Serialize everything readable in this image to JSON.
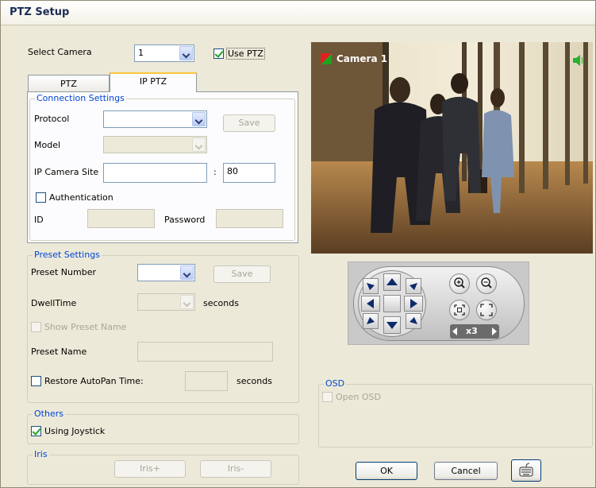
{
  "window": {
    "title": "PTZ Setup"
  },
  "camera": {
    "label": "Select Camera",
    "value": "1",
    "use_ptz_label": "Use PTZ",
    "use_ptz_checked": true
  },
  "tabs": [
    {
      "label": "PTZ",
      "active": false
    },
    {
      "label": "IP PTZ",
      "active": true
    }
  ],
  "connection": {
    "legend": "Connection Settings",
    "protocol_label": "Protocol",
    "protocol_value": "",
    "save_label": "Save",
    "model_label": "Model",
    "model_value": "",
    "site_label": "IP Camera Site",
    "site_value": "",
    "port_sep": ":",
    "port_value": "80",
    "auth_label": "Authentication",
    "auth_checked": false,
    "id_label": "ID",
    "id_value": "",
    "password_label": "Password",
    "password_value": ""
  },
  "preset": {
    "legend": "Preset Settings",
    "number_label": "Preset Number",
    "number_value": "",
    "save_label": "Save",
    "dwell_label": "DwellTime",
    "dwell_value": "",
    "dwell_unit": "seconds",
    "show_name_label": "Show Preset Name",
    "name_label": "Preset Name",
    "name_value": "",
    "autopan_label": "Restore AutoPan Time:",
    "autopan_value": "",
    "autopan_unit": "seconds"
  },
  "others": {
    "legend": "Others",
    "joystick_label": "Using Joystick",
    "joystick_checked": true
  },
  "iris": {
    "legend": "Iris",
    "plus_label": "Iris+",
    "minus_label": "Iris-"
  },
  "video": {
    "camera_label": "Camera 1"
  },
  "ptz_panel": {
    "zoom_label": "x3"
  },
  "osd": {
    "legend": "OSD",
    "open_label": "Open OSD"
  },
  "buttons": {
    "ok": "OK",
    "cancel": "Cancel"
  },
  "icons": {
    "dropdown": "chevron-down-icon",
    "speaker": "speaker-icon",
    "camera_flag": "camera-flag-icon",
    "zoom_in": "zoom-in-icon",
    "zoom_out": "zoom-out-icon",
    "focus_near": "focus-near-icon",
    "focus_far": "focus-far-icon",
    "keyboard": "keyboard-icon"
  },
  "colors": {
    "window_bg": "#ece9d8",
    "legend_text": "#0046d5",
    "title_text": "#1b2c55",
    "check_green": "#21a121",
    "tab_highlight": "#ffc73c"
  }
}
